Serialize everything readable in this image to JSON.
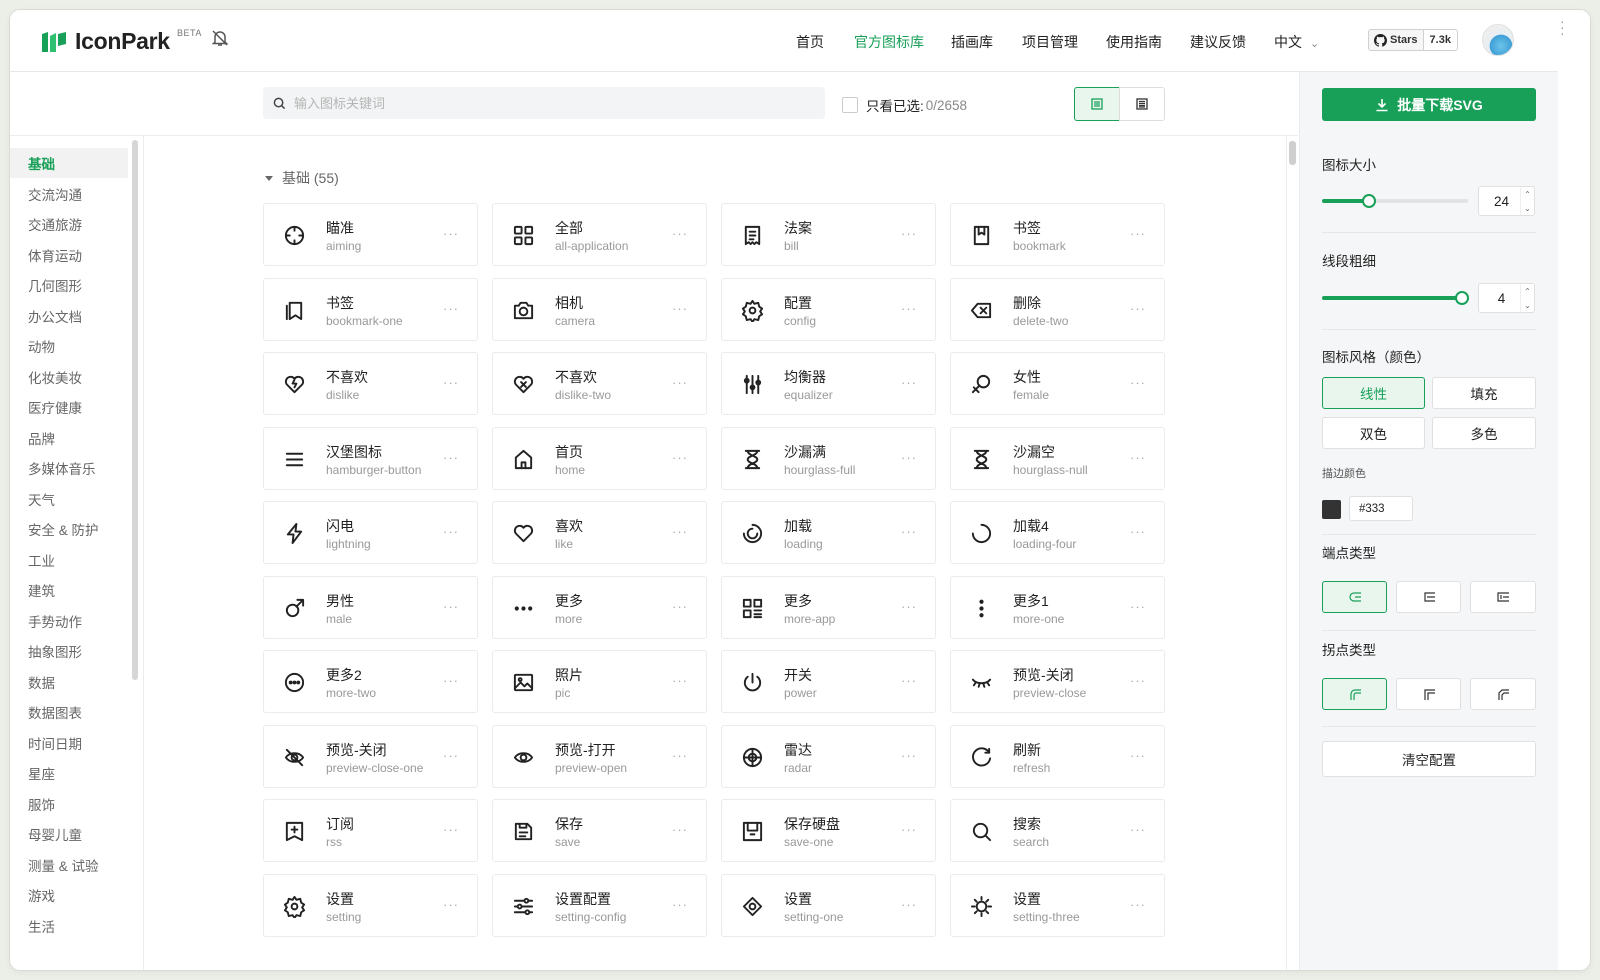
{
  "app": {
    "name": "IconPark",
    "beta": "BETA"
  },
  "nav": [
    "首页",
    "官方图标库",
    "插画库",
    "项目管理",
    "使用指南",
    "建议反馈",
    "中文"
  ],
  "github": {
    "label": "Stars",
    "count": "7.3k"
  },
  "search": {
    "placeholder": "输入图标关键词"
  },
  "only_selected": {
    "label": "只看已选:",
    "count": "0/2658"
  },
  "sidebar": [
    "基础",
    "交流沟通",
    "交通旅游",
    "体育运动",
    "几何图形",
    "办公文档",
    "动物",
    "化妆美妆",
    "医疗健康",
    "品牌",
    "多媒体音乐",
    "天气",
    "安全 & 防护",
    "工业",
    "建筑",
    "手势动作",
    "抽象图形",
    "数据",
    "数据图表",
    "时间日期",
    "星座",
    "服饰",
    "母婴儿童",
    "测量 & 试验",
    "游戏",
    "生活"
  ],
  "group": {
    "title": "基础 (55)"
  },
  "icons": [
    {
      "cn": "瞄准",
      "en": "aiming",
      "icon": "aiming-icon"
    },
    {
      "cn": "全部",
      "en": "all-application",
      "icon": "all-application-icon"
    },
    {
      "cn": "法案",
      "en": "bill",
      "icon": "bill-icon"
    },
    {
      "cn": "书签",
      "en": "bookmark",
      "icon": "bookmark-icon"
    },
    {
      "cn": "书签",
      "en": "bookmark-one",
      "icon": "bookmark-one-icon"
    },
    {
      "cn": "相机",
      "en": "camera",
      "icon": "camera-icon"
    },
    {
      "cn": "配置",
      "en": "config",
      "icon": "config-icon"
    },
    {
      "cn": "删除",
      "en": "delete-two",
      "icon": "delete-two-icon"
    },
    {
      "cn": "不喜欢",
      "en": "dislike",
      "icon": "dislike-icon"
    },
    {
      "cn": "不喜欢",
      "en": "dislike-two",
      "icon": "dislike-two-icon"
    },
    {
      "cn": "均衡器",
      "en": "equalizer",
      "icon": "equalizer-icon"
    },
    {
      "cn": "女性",
      "en": "female",
      "icon": "female-icon"
    },
    {
      "cn": "汉堡图标",
      "en": "hamburger-button",
      "icon": "hamburger-button-icon"
    },
    {
      "cn": "首页",
      "en": "home",
      "icon": "home-icon"
    },
    {
      "cn": "沙漏满",
      "en": "hourglass-full",
      "icon": "hourglass-full-icon"
    },
    {
      "cn": "沙漏空",
      "en": "hourglass-null",
      "icon": "hourglass-null-icon"
    },
    {
      "cn": "闪电",
      "en": "lightning",
      "icon": "lightning-icon"
    },
    {
      "cn": "喜欢",
      "en": "like",
      "icon": "like-icon"
    },
    {
      "cn": "加载",
      "en": "loading",
      "icon": "loading-icon"
    },
    {
      "cn": "加载4",
      "en": "loading-four",
      "icon": "loading-four-icon"
    },
    {
      "cn": "男性",
      "en": "male",
      "icon": "male-icon"
    },
    {
      "cn": "更多",
      "en": "more",
      "icon": "more-icon"
    },
    {
      "cn": "更多",
      "en": "more-app",
      "icon": "more-app-icon"
    },
    {
      "cn": "更多1",
      "en": "more-one",
      "icon": "more-one-icon"
    },
    {
      "cn": "更多2",
      "en": "more-two",
      "icon": "more-two-icon"
    },
    {
      "cn": "照片",
      "en": "pic",
      "icon": "pic-icon"
    },
    {
      "cn": "开关",
      "en": "power",
      "icon": "power-icon"
    },
    {
      "cn": "预览-关闭",
      "en": "preview-close",
      "icon": "preview-close-icon"
    },
    {
      "cn": "预览-关闭",
      "en": "preview-close-one",
      "icon": "preview-close-one-icon"
    },
    {
      "cn": "预览-打开",
      "en": "preview-open",
      "icon": "preview-open-icon"
    },
    {
      "cn": "雷达",
      "en": "radar",
      "icon": "radar-icon"
    },
    {
      "cn": "刷新",
      "en": "refresh",
      "icon": "refresh-icon"
    },
    {
      "cn": "订阅",
      "en": "rss",
      "icon": "rss-icon"
    },
    {
      "cn": "保存",
      "en": "save",
      "icon": "save-icon"
    },
    {
      "cn": "保存硬盘",
      "en": "save-one",
      "icon": "save-one-icon"
    },
    {
      "cn": "搜索",
      "en": "search",
      "icon": "search-icon"
    },
    {
      "cn": "设置",
      "en": "setting",
      "icon": "setting-icon"
    },
    {
      "cn": "设置配置",
      "en": "setting-config",
      "icon": "setting-config-icon"
    },
    {
      "cn": "设置",
      "en": "setting-one",
      "icon": "setting-one-icon"
    },
    {
      "cn": "设置",
      "en": "setting-three",
      "icon": "setting-three-icon"
    }
  ],
  "more_dots": "···",
  "panel": {
    "download": "批量下载SVG",
    "size_label": "图标大小",
    "size_value": "24",
    "size_fraction": 0.32,
    "stroke_label": "线段粗细",
    "stroke_value": "4",
    "stroke_fraction": 0.96,
    "style_label": "图标风格（颜色）",
    "styles": [
      "线性",
      "填充",
      "双色",
      "多色"
    ],
    "stroke_color_label": "描边颜色",
    "stroke_color": "#333",
    "cap_label": "端点类型",
    "join_label": "拐点类型",
    "clear": "清空配置"
  },
  "colors": {
    "accent": "#18a058",
    "text": "#333"
  }
}
